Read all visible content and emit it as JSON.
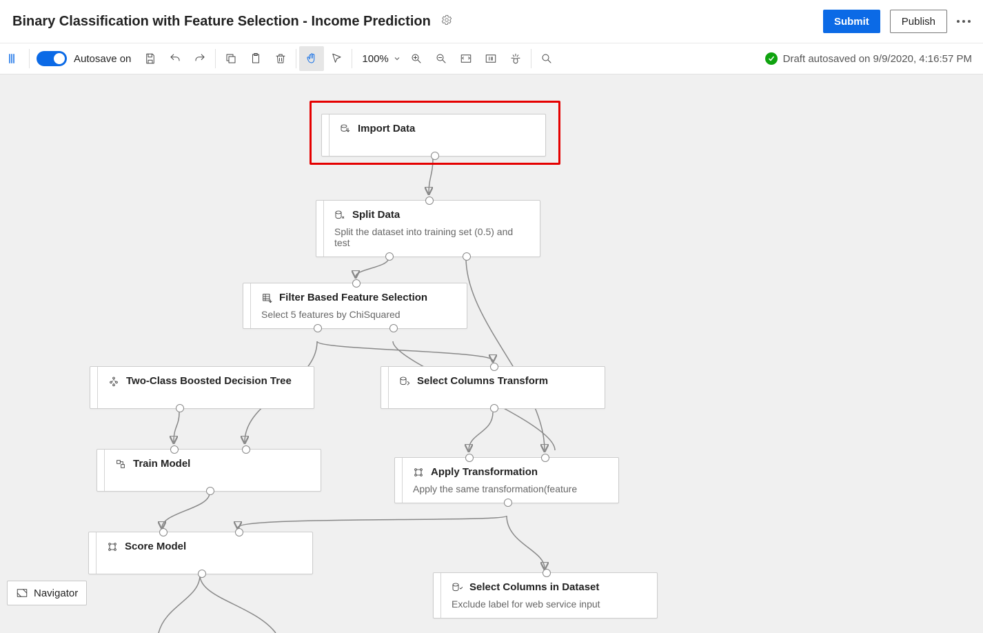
{
  "header": {
    "title": "Binary Classification with Feature Selection - Income Prediction",
    "submit": "Submit",
    "publish": "Publish"
  },
  "toolbar": {
    "autosave_label": "Autosave on",
    "zoom": "100%",
    "status": "Draft autosaved on 9/9/2020, 4:16:57 PM"
  },
  "nodes": {
    "import_data": {
      "title": "Import Data"
    },
    "split_data": {
      "title": "Split Data",
      "subtitle": "Split the dataset into training set (0.5) and test"
    },
    "filter_feat": {
      "title": "Filter Based Feature Selection",
      "subtitle": "Select 5 features by ChiSquared"
    },
    "boosted": {
      "title": "Two-Class Boosted Decision Tree"
    },
    "sel_col_tx": {
      "title": "Select Columns Transform"
    },
    "train": {
      "title": "Train Model"
    },
    "apply_tx": {
      "title": "Apply Transformation",
      "subtitle": "Apply the same transformation(feature"
    },
    "score": {
      "title": "Score Model"
    },
    "sel_col_ds": {
      "title": "Select Columns in Dataset",
      "subtitle": "Exclude label for web service input"
    }
  },
  "navigator": {
    "label": "Navigator"
  }
}
